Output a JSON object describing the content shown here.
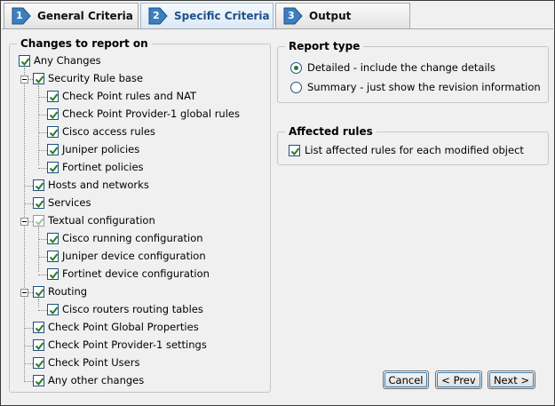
{
  "tabs": [
    {
      "number": "1",
      "label": "General Criteria",
      "active": false
    },
    {
      "number": "2",
      "label": "Specific Criteria",
      "active": true
    },
    {
      "number": "3",
      "label": "Output",
      "active": false
    }
  ],
  "changes_group": {
    "title": "Changes to report on",
    "items": [
      {
        "label": "Any Changes",
        "checked": true
      },
      {
        "label": "Security Rule base",
        "checked": true
      },
      {
        "label": "Check Point rules and NAT",
        "checked": true
      },
      {
        "label": "Check Point Provider-1 global rules",
        "checked": true
      },
      {
        "label": "Cisco access rules",
        "checked": true
      },
      {
        "label": "Juniper policies",
        "checked": true
      },
      {
        "label": "Fortinet policies",
        "checked": true
      },
      {
        "label": "Hosts and networks",
        "checked": true
      },
      {
        "label": "Services",
        "checked": true
      },
      {
        "label": "Textual configuration",
        "checked": true,
        "greyed": true
      },
      {
        "label": "Cisco running configuration",
        "checked": true
      },
      {
        "label": "Juniper device configuration",
        "checked": true
      },
      {
        "label": "Fortinet device configuration",
        "checked": true
      },
      {
        "label": "Routing",
        "checked": true
      },
      {
        "label": "Cisco routers routing tables",
        "checked": true
      },
      {
        "label": "Check Point Global Properties",
        "checked": true
      },
      {
        "label": "Check Point Provider-1 settings",
        "checked": true
      },
      {
        "label": "Check Point Users",
        "checked": true
      },
      {
        "label": "Any other changes",
        "checked": true
      }
    ]
  },
  "report_type": {
    "title": "Report type",
    "options": [
      {
        "label": "Detailed - include the change details",
        "selected": true
      },
      {
        "label": "Summary - just show the revision information",
        "selected": false
      }
    ]
  },
  "affected_rules": {
    "title": "Affected rules",
    "option": {
      "label": "List affected rules for each modified object",
      "checked": true
    }
  },
  "buttons": {
    "cancel": "Cancel",
    "prev": "< Prev",
    "next": "Next >"
  },
  "colors": {
    "check": "#2a7a2a",
    "active_tab_text": "#1f4f8a",
    "step_badge": "#3c7fc0"
  }
}
